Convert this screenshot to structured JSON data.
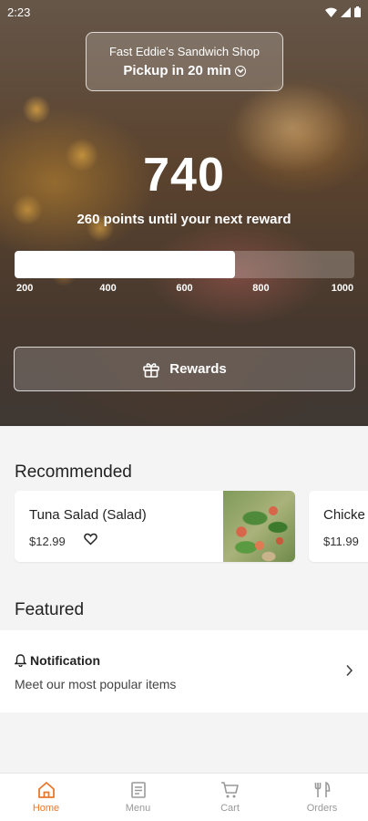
{
  "status_bar": {
    "time": "2:23"
  },
  "shop": {
    "name": "Fast Eddie's Sandwich Shop",
    "pickup": "Pickup in 20 min"
  },
  "rewards": {
    "points": "740",
    "subtitle": "260 points until your next reward",
    "progress_fraction": 0.65,
    "ticks": [
      "200",
      "400",
      "600",
      "800",
      "1000"
    ],
    "button_label": "Rewards"
  },
  "recommended": {
    "title": "Recommended",
    "items": [
      {
        "name": "Tuna Salad (Salad)",
        "price": "$12.99"
      },
      {
        "name": "Chicke",
        "price": "$11.99"
      }
    ]
  },
  "featured": {
    "title": "Featured",
    "notification_title": "Notification",
    "notification_sub": "Meet our most popular items"
  },
  "nav": {
    "items": [
      {
        "label": "Home",
        "icon": "home-icon"
      },
      {
        "label": "Menu",
        "icon": "menu-icon"
      },
      {
        "label": "Cart",
        "icon": "cart-icon"
      },
      {
        "label": "Orders",
        "icon": "orders-icon"
      }
    ]
  },
  "colors": {
    "accent": "#e8782e",
    "inactive": "#999999"
  }
}
